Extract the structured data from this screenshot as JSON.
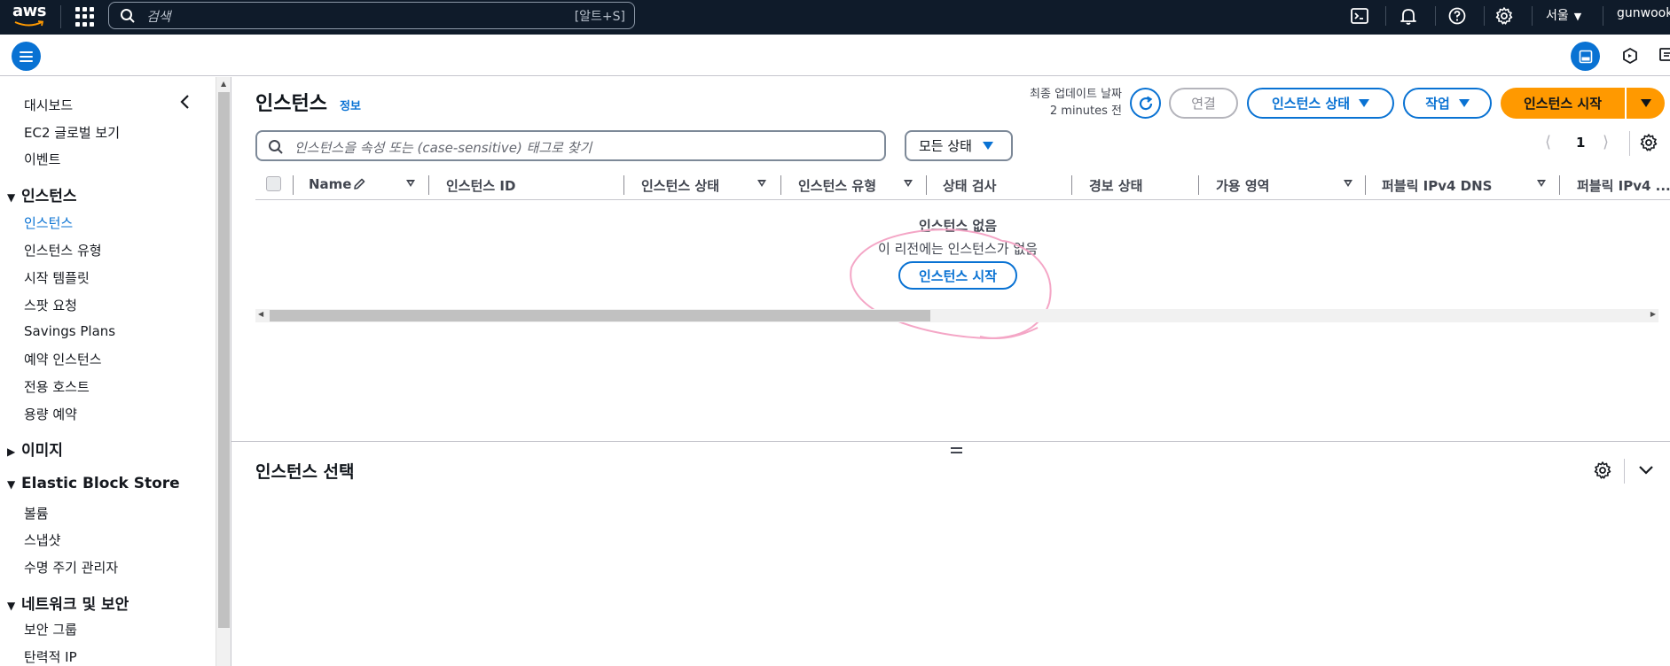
{
  "topnav": {
    "logo_text": "aws",
    "search_placeholder": "검색",
    "search_shortcut": "[알트+S]",
    "icons": [
      "cloudshell-icon",
      "bell-icon",
      "help-icon",
      "gear-icon"
    ],
    "region": "서울",
    "user": "gunwook"
  },
  "sidebar": {
    "top_items": [
      {
        "label": "대시보드"
      },
      {
        "label": "EC2 글로벌 보기"
      },
      {
        "label": "이벤트"
      }
    ],
    "sections": [
      {
        "label": "인스턴스",
        "expanded": true,
        "items": [
          "인스턴스",
          "인스턴스 유형",
          "시작 템플릿",
          "스팟 요청",
          "Savings Plans",
          "예약 인스턴스",
          "전용 호스트",
          "용량 예약"
        ],
        "active": "인스턴스"
      },
      {
        "label": "이미지",
        "expanded": false,
        "items": []
      },
      {
        "label": "Elastic Block Store",
        "expanded": true,
        "items": [
          "볼륨",
          "스냅샷",
          "수명 주기 관리자"
        ]
      },
      {
        "label": "네트워크 및 보안",
        "expanded": true,
        "items": [
          "보안 그룹",
          "탄력적 IP"
        ]
      }
    ]
  },
  "header": {
    "title": "인스턴스",
    "info_link": "정보",
    "last_updated_label": "최종 업데이트 날짜",
    "last_updated_value": "2 minutes 전",
    "connect_label": "연결",
    "instance_state_label": "인스턴스 상태",
    "actions_label": "작업",
    "launch_label": "인스턴스 시작"
  },
  "filter": {
    "placeholder": "인스턴스을 속성 또는 (case-sensitive) 태그로 찾기",
    "state_select": "모든 상태"
  },
  "pagination": {
    "current_page": "1"
  },
  "table": {
    "columns": [
      "Name",
      "인스턴스 ID",
      "인스턴스 상태",
      "인스턴스 유형",
      "상태 검사",
      "경보 상태",
      "가용 영역",
      "퍼블릭 IPv4 DNS",
      "퍼블릭 IPv4 ..."
    ],
    "empty_title": "인스턴스 없음",
    "empty_message": "이 리전에는 인스턴스가 없음",
    "empty_button": "인스턴스 시작"
  },
  "split_panel": {
    "title": "인스턴스 선택"
  },
  "colors": {
    "nav_bg": "#0f1b2a",
    "accent": "#0972d3",
    "primary": "#ff9900",
    "annotation": "#f4a6c6"
  }
}
